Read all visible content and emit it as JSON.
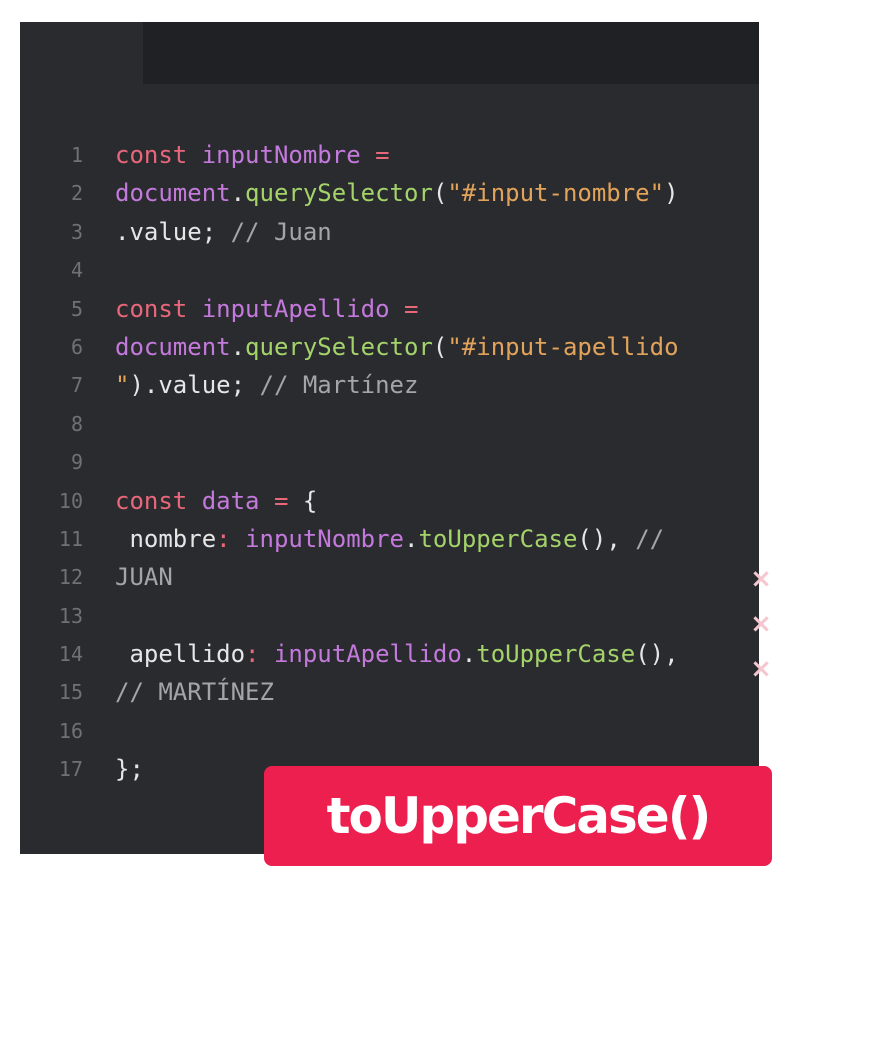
{
  "code": {
    "lines": [
      {
        "number": "1",
        "tokens": [
          {
            "t": "const ",
            "c": "kw"
          },
          {
            "t": "inputNombre ",
            "c": "var"
          },
          {
            "t": "=",
            "c": "op"
          }
        ]
      },
      {
        "number": "2",
        "tokens": [
          {
            "t": "document",
            "c": "var"
          },
          {
            "t": ".",
            "c": "plain"
          },
          {
            "t": "querySelector",
            "c": "fn"
          },
          {
            "t": "(",
            "c": "plain"
          },
          {
            "t": "\"#input-nombre\"",
            "c": "str"
          },
          {
            "t": ")",
            "c": "plain"
          }
        ]
      },
      {
        "number": "3",
        "tokens": [
          {
            "t": ".value; ",
            "c": "plain"
          },
          {
            "t": "// Juan",
            "c": "cm"
          }
        ]
      },
      {
        "number": "4",
        "tokens": []
      },
      {
        "number": "5",
        "tokens": [
          {
            "t": "const ",
            "c": "kw"
          },
          {
            "t": "inputApellido ",
            "c": "var"
          },
          {
            "t": "=",
            "c": "op"
          }
        ]
      },
      {
        "number": "6",
        "tokens": [
          {
            "t": "document",
            "c": "var"
          },
          {
            "t": ".",
            "c": "plain"
          },
          {
            "t": "querySelector",
            "c": "fn"
          },
          {
            "t": "(",
            "c": "plain"
          },
          {
            "t": "\"#input-apellido",
            "c": "str"
          }
        ]
      },
      {
        "number": "7",
        "tokens": [
          {
            "t": "\"",
            "c": "str"
          },
          {
            "t": ").value; ",
            "c": "plain"
          },
          {
            "t": "// Martínez",
            "c": "cm"
          }
        ]
      },
      {
        "number": "8",
        "tokens": []
      },
      {
        "number": "9",
        "tokens": []
      },
      {
        "number": "10",
        "tokens": [
          {
            "t": "const ",
            "c": "kw"
          },
          {
            "t": "data ",
            "c": "var"
          },
          {
            "t": "= ",
            "c": "op"
          },
          {
            "t": "{",
            "c": "plain"
          }
        ]
      },
      {
        "number": "11",
        "tokens": [
          {
            "t": " nombre",
            "c": "plain"
          },
          {
            "t": ": ",
            "c": "op"
          },
          {
            "t": "inputNombre",
            "c": "var"
          },
          {
            "t": ".",
            "c": "plain"
          },
          {
            "t": "toUpperCase",
            "c": "fn"
          },
          {
            "t": "(), ",
            "c": "plain"
          },
          {
            "t": "//",
            "c": "cm"
          }
        ]
      },
      {
        "number": "12",
        "tokens": [
          {
            "t": "JUAN",
            "c": "cm"
          }
        ]
      },
      {
        "number": "13",
        "tokens": []
      },
      {
        "number": "14",
        "tokens": [
          {
            "t": " apellido",
            "c": "plain"
          },
          {
            "t": ": ",
            "c": "op"
          },
          {
            "t": "inputApellido",
            "c": "var"
          },
          {
            "t": ".",
            "c": "plain"
          },
          {
            "t": "toUpperCase",
            "c": "fn"
          },
          {
            "t": "(),",
            "c": "plain"
          }
        ]
      },
      {
        "number": "15",
        "tokens": [
          {
            "t": "// MARTÍNEZ",
            "c": "cm"
          }
        ]
      },
      {
        "number": "16",
        "tokens": []
      },
      {
        "number": "17",
        "tokens": [
          {
            "t": "};",
            "c": "plain"
          }
        ]
      }
    ]
  },
  "badge": {
    "label": "toUpperCase()"
  },
  "decor": {
    "mark_glyph": "×",
    "mark_count": 3
  },
  "colors": {
    "editor_bg": "#2a2b2f",
    "tabbar_bg": "#202124",
    "keyword": "#e9677a",
    "variable": "#c479dc",
    "function": "#a4d36a",
    "string": "#e2a35a",
    "comment": "#a3a5a8",
    "badge_bg": "#ec1f4f"
  }
}
